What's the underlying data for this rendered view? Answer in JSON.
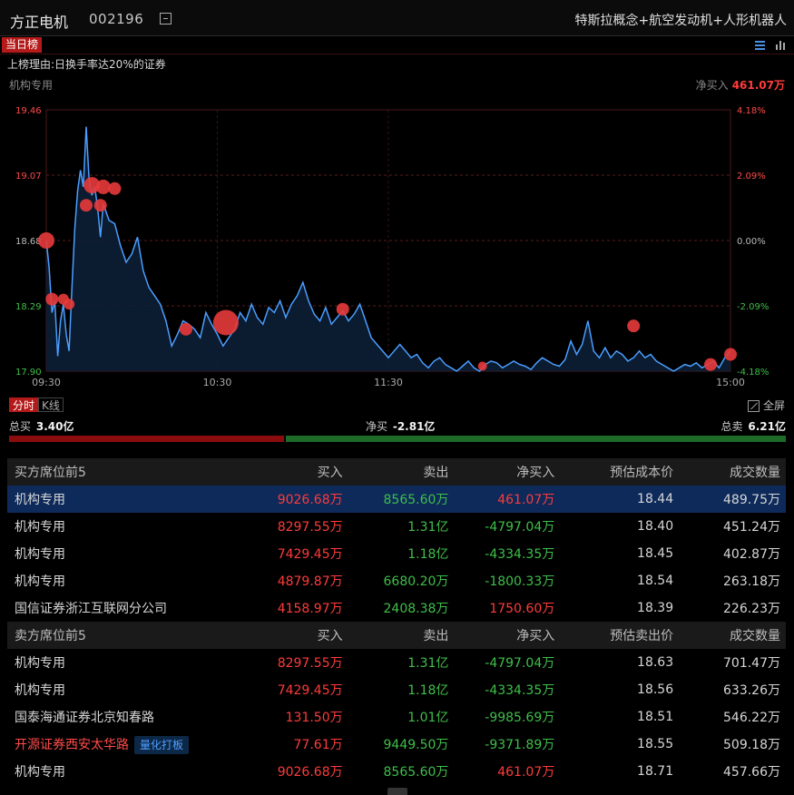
{
  "header": {
    "stock_name": "方正电机",
    "stock_code": "002196",
    "concepts": "特斯拉概念+航空发动机+人形机器人"
  },
  "tabs": {
    "today": "当日榜"
  },
  "reason": "上榜理由:日换手率达20%的证券",
  "chart_header": {
    "seat": "机构专用",
    "net_buy_label": "净买入",
    "net_buy_value": "461.07万"
  },
  "chart_data": {
    "type": "line",
    "y_left_ticks": [
      "19.46",
      "19.07",
      "18.68",
      "18.29",
      "17.90"
    ],
    "y_right_ticks": [
      "4.18%",
      "2.09%",
      "0.00%",
      "-2.09%",
      "-4.18%"
    ],
    "ylim": [
      17.9,
      19.46
    ],
    "x_ticks": [
      "09:30",
      "10:30",
      "11:30",
      "15:00"
    ],
    "x_max_minutes": 240,
    "series": [
      {
        "x": [
          0,
          1,
          2,
          3,
          4,
          5,
          6,
          7,
          8,
          9,
          10,
          11,
          12,
          13,
          14,
          15,
          16,
          17,
          18,
          19,
          20,
          22,
          24,
          26,
          28,
          30,
          32,
          34,
          36,
          38,
          40,
          42,
          44,
          46,
          48,
          50,
          52,
          54,
          56,
          58,
          60,
          62,
          64,
          66,
          68,
          70,
          72,
          74,
          76,
          78,
          80,
          82,
          84,
          86,
          88,
          90,
          92,
          94,
          96,
          98,
          100,
          102,
          104,
          106,
          108,
          110,
          112,
          114,
          116,
          118,
          120,
          122,
          124,
          126,
          128,
          130,
          132,
          134,
          136,
          138,
          140,
          142,
          144,
          146,
          148,
          150,
          152,
          154,
          156,
          158,
          160,
          162,
          164,
          166,
          168,
          170,
          172,
          174,
          176,
          178,
          180,
          182,
          184,
          186,
          188,
          190,
          192,
          194,
          196,
          198,
          200,
          202,
          204,
          206,
          208,
          210,
          212,
          214,
          216,
          218,
          220,
          222,
          224,
          226,
          228,
          230,
          232,
          234,
          236,
          238,
          240
        ],
        "y": [
          18.68,
          18.52,
          18.25,
          18.32,
          17.99,
          18.2,
          18.3,
          18.12,
          18.02,
          18.4,
          18.75,
          18.98,
          19.1,
          19.0,
          19.36,
          19.05,
          18.95,
          19.0,
          18.88,
          18.7,
          18.9,
          18.8,
          18.78,
          18.65,
          18.55,
          18.6,
          18.7,
          18.5,
          18.4,
          18.35,
          18.3,
          18.2,
          18.05,
          18.12,
          18.2,
          18.18,
          18.15,
          18.1,
          18.25,
          18.18,
          18.12,
          18.05,
          18.1,
          18.15,
          18.25,
          18.2,
          18.3,
          18.22,
          18.18,
          18.28,
          18.25,
          18.32,
          18.22,
          18.3,
          18.35,
          18.43,
          18.32,
          18.24,
          18.2,
          18.28,
          18.18,
          18.22,
          18.26,
          18.2,
          18.24,
          18.3,
          18.2,
          18.1,
          18.06,
          18.02,
          17.98,
          18.02,
          18.06,
          18.02,
          17.98,
          18.0,
          17.95,
          17.92,
          17.96,
          17.98,
          17.94,
          17.92,
          17.9,
          17.93,
          17.96,
          17.92,
          17.9,
          17.94,
          17.96,
          17.95,
          17.92,
          17.94,
          17.96,
          17.94,
          17.93,
          17.91,
          17.95,
          17.98,
          17.96,
          17.94,
          17.93,
          17.97,
          18.08,
          18.0,
          18.06,
          18.2,
          18.02,
          17.98,
          18.04,
          17.98,
          18.02,
          18.0,
          17.96,
          17.98,
          18.02,
          17.98,
          18.0,
          17.96,
          17.94,
          17.92,
          17.9,
          17.92,
          17.94,
          17.93,
          17.95,
          17.92,
          17.94,
          17.96,
          17.92,
          17.98,
          18.02
        ]
      }
    ],
    "markers": [
      {
        "x": 0,
        "y": 18.68,
        "r": 9
      },
      {
        "x": 2,
        "y": 18.33,
        "r": 7
      },
      {
        "x": 6,
        "y": 18.33,
        "r": 6
      },
      {
        "x": 8,
        "y": 18.3,
        "r": 6
      },
      {
        "x": 14,
        "y": 18.89,
        "r": 7
      },
      {
        "x": 16,
        "y": 19.01,
        "r": 9
      },
      {
        "x": 19,
        "y": 18.89,
        "r": 7
      },
      {
        "x": 20,
        "y": 19.0,
        "r": 8
      },
      {
        "x": 24,
        "y": 18.99,
        "r": 7
      },
      {
        "x": 49,
        "y": 18.15,
        "r": 7
      },
      {
        "x": 63,
        "y": 18.19,
        "r": 14
      },
      {
        "x": 104,
        "y": 18.27,
        "r": 7
      },
      {
        "x": 153,
        "y": 17.93,
        "r": 5
      },
      {
        "x": 206,
        "y": 18.17,
        "r": 7
      },
      {
        "x": 233,
        "y": 17.94,
        "r": 7
      },
      {
        "x": 240,
        "y": 18.0,
        "r": 7
      }
    ]
  },
  "mode_tabs": {
    "minute": "分时",
    "kline": "K线"
  },
  "fullscreen_label": "全屏",
  "totals": {
    "total_buy_label": "总买",
    "total_buy": "3.40亿",
    "net_buy_label": "净买",
    "net_buy": "-2.81亿",
    "total_sell_label": "总卖",
    "total_sell": "6.21亿",
    "buy_ratio": 0.354
  },
  "buy_table": {
    "headers": [
      "买方席位前5",
      "买入",
      "卖出",
      "净买入",
      "预估成本价",
      "成交数量"
    ],
    "rows": [
      {
        "seat": "机构专用",
        "buy": "9026.68万",
        "sell": "8565.60万",
        "net": "461.07万",
        "price": "18.44",
        "vol": "489.75万"
      },
      {
        "seat": "机构专用",
        "buy": "8297.55万",
        "sell": "1.31亿",
        "net": "-4797.04万",
        "price": "18.40",
        "vol": "451.24万"
      },
      {
        "seat": "机构专用",
        "buy": "7429.45万",
        "sell": "1.18亿",
        "net": "-4334.35万",
        "price": "18.45",
        "vol": "402.87万"
      },
      {
        "seat": "机构专用",
        "buy": "4879.87万",
        "sell": "6680.20万",
        "net": "-1800.33万",
        "price": "18.54",
        "vol": "263.18万"
      },
      {
        "seat": "国信证券浙江互联网分公司",
        "buy": "4158.97万",
        "sell": "2408.38万",
        "net": "1750.60万",
        "price": "18.39",
        "vol": "226.23万"
      }
    ]
  },
  "sell_table": {
    "headers": [
      "卖方席位前5",
      "买入",
      "卖出",
      "净买入",
      "预估卖出价",
      "成交数量"
    ],
    "rows": [
      {
        "seat": "机构专用",
        "buy": "8297.55万",
        "sell": "1.31亿",
        "net": "-4797.04万",
        "price": "18.63",
        "vol": "701.47万"
      },
      {
        "seat": "机构专用",
        "buy": "7429.45万",
        "sell": "1.18亿",
        "net": "-4334.35万",
        "price": "18.56",
        "vol": "633.26万"
      },
      {
        "seat": "国泰海通证券北京知春路",
        "buy": "131.50万",
        "sell": "1.01亿",
        "net": "-9985.69万",
        "price": "18.51",
        "vol": "546.22万"
      },
      {
        "seat": "开源证券西安太华路",
        "tag": "量化打板",
        "buy": "77.61万",
        "sell": "9449.50万",
        "net": "-9371.89万",
        "price": "18.55",
        "vol": "509.18万"
      },
      {
        "seat": "机构专用",
        "buy": "9026.68万",
        "sell": "8565.60万",
        "net": "461.07万",
        "price": "18.71",
        "vol": "457.66万"
      }
    ]
  },
  "colors": {
    "up": "#ff3b3b",
    "down": "#3fbf4a",
    "line": "#4a9eff",
    "selected_row": "#0d2a5a",
    "accent": "#b51a1a"
  }
}
